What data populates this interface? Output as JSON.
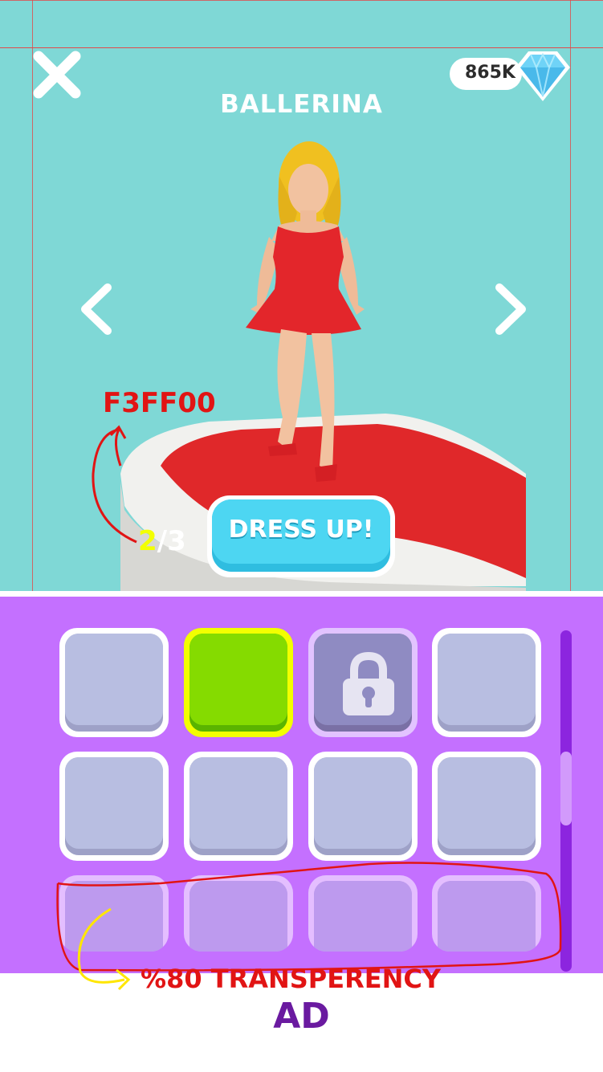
{
  "header": {
    "close_icon": "close-icon",
    "currency_value": "865K",
    "currency_icon": "diamond-icon",
    "title": "BALLERINA"
  },
  "nav": {
    "prev_icon": "chevron-left-icon",
    "next_icon": "chevron-right-icon"
  },
  "annotations": {
    "color_code": "F3FF00",
    "transparency_note": "%80 TRANSPERENCY"
  },
  "counter": {
    "current": "2",
    "total": "/3"
  },
  "dress_button": {
    "label": "DRESS UP!"
  },
  "grid": {
    "rows": 3,
    "columns": 4,
    "selected_index": 1,
    "locked_index": 2,
    "faded_row": 3
  },
  "ad": {
    "label": "AD"
  },
  "colors": {
    "background": "#7fd8d6",
    "panel": "#c470ff",
    "selected_border": "#f3ff00",
    "selected_fill": "#85db00",
    "button": "#4dd6f2",
    "annotation": "#e11414",
    "ad_text": "#6a1aa0"
  }
}
